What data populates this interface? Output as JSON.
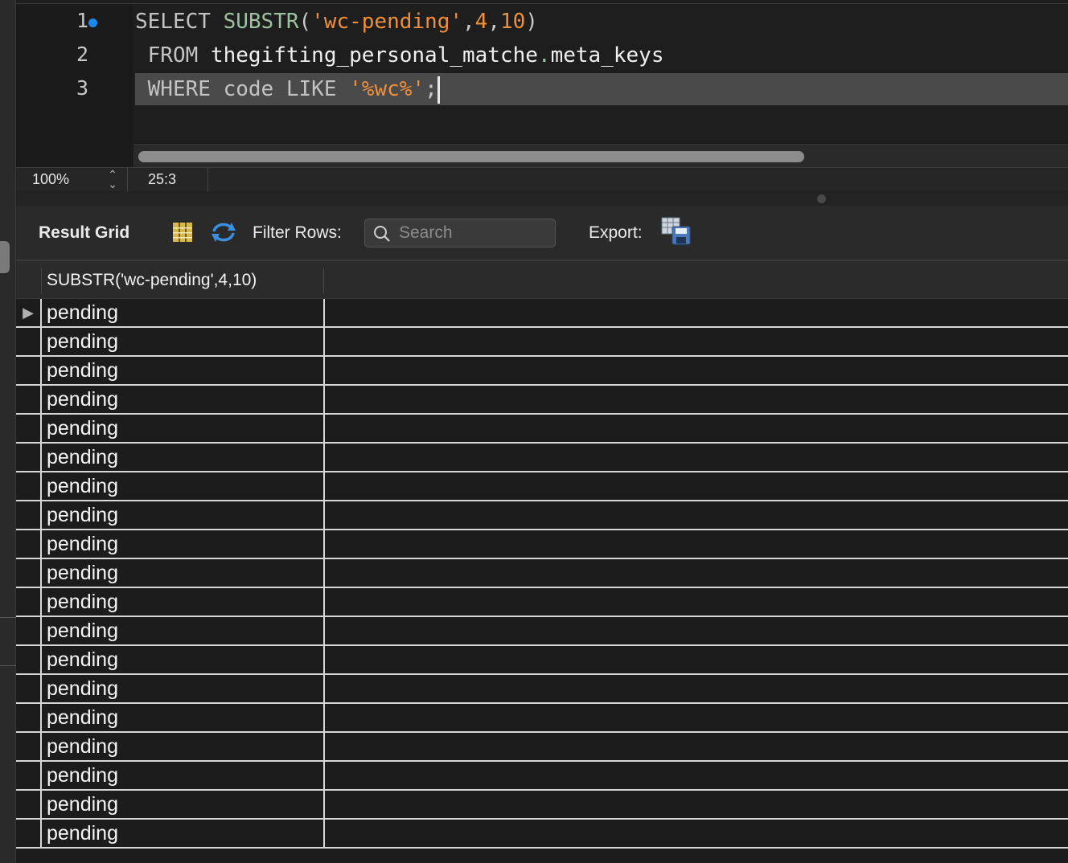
{
  "editor": {
    "line_numbers": [
      "1",
      "2",
      "3"
    ],
    "lines": [
      {
        "tokens": [
          "SELECT",
          " ",
          "SUBSTR",
          "(",
          "'wc-pending'",
          ",",
          "4",
          ",",
          "10",
          ")"
        ]
      },
      {
        "tokens": [
          " FROM",
          " ",
          "thegifting_personal_matche",
          ".",
          "meta_keys"
        ]
      },
      {
        "tokens": [
          " WHERE",
          " ",
          "code",
          " ",
          "LIKE",
          " ",
          "'%wc%'",
          ";"
        ]
      }
    ]
  },
  "status": {
    "zoom": "100%",
    "cursor_position": "25:3"
  },
  "toolbar": {
    "result_grid_label": "Result Grid",
    "filter_label": "Filter Rows:",
    "search_placeholder": "Search",
    "export_label": "Export:"
  },
  "grid": {
    "columns": [
      "SUBSTR('wc-pending',4,10)"
    ],
    "rows": [
      "pending",
      "pending",
      "pending",
      "pending",
      "pending",
      "pending",
      "pending",
      "pending",
      "pending",
      "pending",
      "pending",
      "pending",
      "pending",
      "pending",
      "pending",
      "pending",
      "pending",
      "pending",
      "pending"
    ],
    "selected_indicator": "▶"
  },
  "colors": {
    "keyword": "#c3c3c3",
    "function": "#9bc29e",
    "string": "#ef8f3a",
    "breakpoint": "#1d88f0"
  }
}
